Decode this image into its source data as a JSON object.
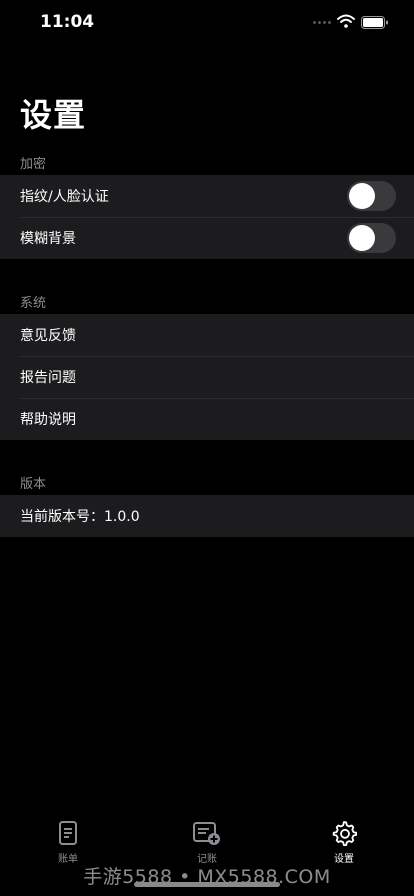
{
  "status_bar": {
    "time": "11:04"
  },
  "page": {
    "title": "设置"
  },
  "sections": [
    {
      "header": "加密",
      "rows": [
        {
          "label": "指纹/人脸认证",
          "toggle": false
        },
        {
          "label": "模糊背景",
          "toggle": false
        }
      ]
    },
    {
      "header": "系统",
      "rows": [
        {
          "label": "意见反馈"
        },
        {
          "label": "报告问题"
        },
        {
          "label": "帮助说明"
        }
      ]
    },
    {
      "header": "版本",
      "rows": [
        {
          "label": "当前版本号：1.0.0"
        }
      ]
    }
  ],
  "tab_bar": {
    "tabs": [
      {
        "label": "账单",
        "icon": "document-icon",
        "active": false
      },
      {
        "label": "记账",
        "icon": "add-entry-icon",
        "active": false
      },
      {
        "label": "设置",
        "icon": "gear-icon",
        "active": true
      }
    ]
  },
  "watermark": "手游5588 • MX5588.COM",
  "colors": {
    "background": "#000000",
    "cell": "#1c1c1e",
    "section_text": "#8d8d92",
    "toggle_off": "#3a3a3c"
  }
}
